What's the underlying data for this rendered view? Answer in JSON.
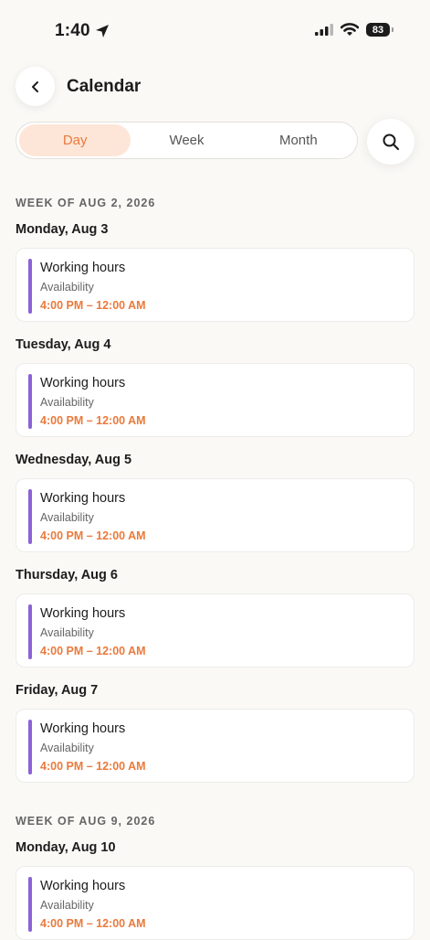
{
  "status_bar": {
    "time": "1:40",
    "battery": "83",
    "icons": [
      "location-arrow-icon",
      "signal-icon",
      "wifi-icon",
      "battery-icon"
    ]
  },
  "header": {
    "title": "Calendar",
    "back_icon": "chevron-left-icon"
  },
  "view_tabs": {
    "items": [
      "Day",
      "Week",
      "Month"
    ],
    "selected": "Day"
  },
  "search_icon": "search-icon",
  "colors": {
    "accent": "#ea7a3c",
    "accent_bg": "#fde6d8",
    "event_bar": "#8b63d8",
    "background": "#faf9f6"
  },
  "weeks": [
    {
      "header": "WEEK OF AUG 2, 2026",
      "days": [
        {
          "date": "Monday, Aug 3",
          "event": {
            "title": "Working hours",
            "subtitle": "Availability",
            "time": "4:00 PM – 12:00 AM"
          }
        },
        {
          "date": "Tuesday, Aug 4",
          "event": {
            "title": "Working hours",
            "subtitle": "Availability",
            "time": "4:00 PM – 12:00 AM"
          }
        },
        {
          "date": "Wednesday, Aug 5",
          "event": {
            "title": "Working hours",
            "subtitle": "Availability",
            "time": "4:00 PM – 12:00 AM"
          }
        },
        {
          "date": "Thursday, Aug 6",
          "event": {
            "title": "Working hours",
            "subtitle": "Availability",
            "time": "4:00 PM – 12:00 AM"
          }
        },
        {
          "date": "Friday, Aug 7",
          "event": {
            "title": "Working hours",
            "subtitle": "Availability",
            "time": "4:00 PM – 12:00 AM"
          }
        }
      ]
    },
    {
      "header": "WEEK OF AUG 9, 2026",
      "days": [
        {
          "date": "Monday, Aug 10",
          "event": {
            "title": "Working hours",
            "subtitle": "Availability",
            "time": "4:00 PM – 12:00 AM"
          }
        }
      ]
    }
  ]
}
